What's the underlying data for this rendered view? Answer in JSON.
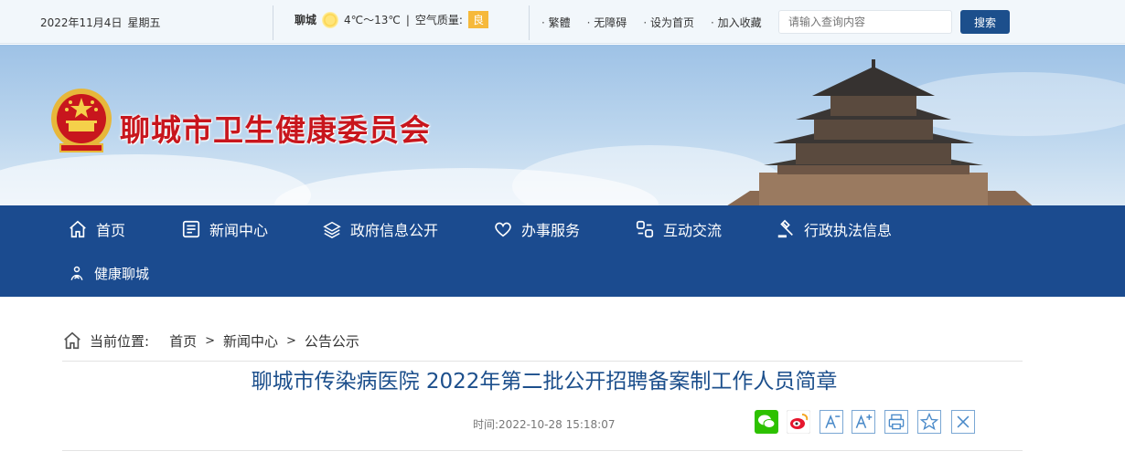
{
  "topbar": {
    "date": "2022年11月4日",
    "weekday": "星期五",
    "city": "聊城",
    "temperature": "4℃～13℃",
    "air_label": "空气质量:",
    "air_value": "良",
    "links": [
      "繁體",
      "无障碍",
      "设为首页",
      "加入收藏"
    ],
    "search_placeholder": "请输入查询内容",
    "search_button": "搜索"
  },
  "header": {
    "site_title": "聊城市卫生健康委员会"
  },
  "nav": {
    "items": [
      "首页",
      "新闻中心",
      "政府信息公开",
      "办事服务",
      "互动交流",
      "行政执法信息",
      "健康聊城"
    ]
  },
  "breadcrumb": {
    "label": "当前位置:",
    "items": [
      "首页",
      "新闻中心",
      "公告公示"
    ],
    "separator": ">"
  },
  "article": {
    "title": "聊城市传染病医院 2022年第二批公开招聘备案制工作人员简章",
    "time": "时间:2022-10-28 15:18:07"
  },
  "colors": {
    "nav_bg": "#1b4b8f",
    "title_red": "#c8161d",
    "article_blue": "#1c4f8c"
  }
}
